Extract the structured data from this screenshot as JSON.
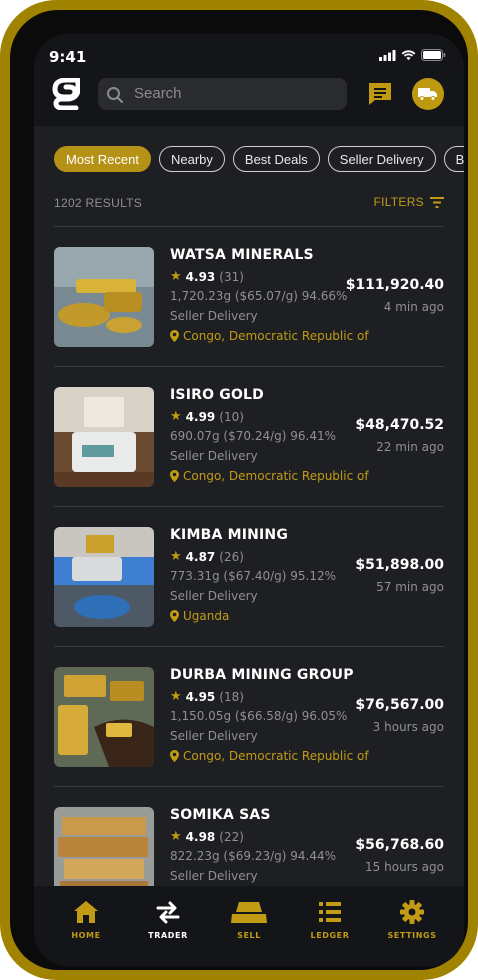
{
  "status": {
    "time": "9:41"
  },
  "header": {
    "search_placeholder": "Search"
  },
  "chips": [
    "Most Recent",
    "Nearby",
    "Best Deals",
    "Seller Delivery",
    "Buy"
  ],
  "results": {
    "count": "1202 RESULTS",
    "filters_label": "FILTERS"
  },
  "listings": [
    {
      "name": "WATSA MINERALS",
      "rating": "4.93",
      "reviews": "(31)",
      "weight": "1,720.23g ($65.07/g) 94.66%",
      "delivery": "Seller Delivery",
      "location": "Congo, Democratic Republic of",
      "price": "$111,920.40",
      "time": "4 min ago"
    },
    {
      "name": "ISIRO GOLD",
      "rating": "4.99",
      "reviews": "(10)",
      "weight": "690.07g ($70.24/g) 96.41%",
      "delivery": "Seller Delivery",
      "location": "Congo, Democratic Republic of",
      "price": "$48,470.52",
      "time": "22 min ago"
    },
    {
      "name": "KIMBA MINING",
      "rating": "4.87",
      "reviews": "(26)",
      "weight": "773.31g ($67.40/g) 95.12%",
      "delivery": "Seller Delivery",
      "location": "Uganda",
      "price": "$51,898.00",
      "time": "57 min ago"
    },
    {
      "name": "DURBA MINING GROUP",
      "rating": "4.95",
      "reviews": "(18)",
      "weight": "1,150.05g ($66.58/g) 96.05%",
      "delivery": "Seller Delivery",
      "location": "Congo, Democratic Republic of",
      "price": "$76,567.00",
      "time": "3 hours ago"
    },
    {
      "name": "SOMIKA SAS",
      "rating": "4.98",
      "reviews": "(22)",
      "weight": "822.23g ($69.23/g) 94.44%",
      "delivery": "Seller Delivery",
      "location": "",
      "price": "$56,768.60",
      "time": "15 hours ago"
    }
  ],
  "tabs": [
    {
      "label": "HOME",
      "icon": "home-icon"
    },
    {
      "label": "TRADER",
      "icon": "swap-arrows-icon"
    },
    {
      "label": "SELL",
      "icon": "gold-bar-icon"
    },
    {
      "label": "LEDGER",
      "icon": "list-icon"
    },
    {
      "label": "SETTINGS",
      "icon": "gear-icon"
    }
  ],
  "colors": {
    "accent": "#c29b14",
    "frame": "#a08300",
    "background": "#1e1f22"
  }
}
